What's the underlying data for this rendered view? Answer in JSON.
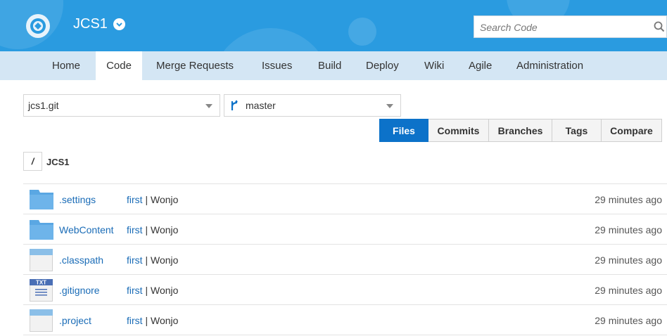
{
  "header": {
    "project_name": "JCS1",
    "search_placeholder": "Search Code"
  },
  "nav": {
    "tabs": [
      {
        "label": "Home"
      },
      {
        "label": "Code",
        "active": true
      },
      {
        "label": "Merge Requests"
      },
      {
        "label": "Issues"
      },
      {
        "label": "Build"
      },
      {
        "label": "Deploy"
      },
      {
        "label": "Wiki"
      },
      {
        "label": "Agile"
      },
      {
        "label": "Administration"
      }
    ]
  },
  "repo": {
    "selected_repo": "jcs1.git",
    "selected_branch": "master"
  },
  "view_buttons": [
    {
      "label": "Files",
      "active": true
    },
    {
      "label": "Commits"
    },
    {
      "label": "Branches"
    },
    {
      "label": "Tags"
    },
    {
      "label": "Compare"
    }
  ],
  "breadcrumb": {
    "root": "/",
    "current": "JCS1"
  },
  "files": [
    {
      "name": ".settings",
      "icon": "folder-icon",
      "commit_message": "first",
      "separator": "|",
      "author": "Wonjo",
      "time": "29 minutes ago"
    },
    {
      "name": "WebContent",
      "icon": "folder-icon",
      "commit_message": "first",
      "separator": "|",
      "author": "Wonjo",
      "time": "29 minutes ago"
    },
    {
      "name": ".classpath",
      "icon": "file-icon",
      "commit_message": "first",
      "separator": "|",
      "author": "Wonjo",
      "time": "29 minutes ago"
    },
    {
      "name": ".gitignore",
      "icon": "txt-file-icon",
      "icon_text": "TXT",
      "commit_message": "first",
      "separator": "|",
      "author": "Wonjo",
      "time": "29 minutes ago"
    },
    {
      "name": ".project",
      "icon": "file-icon",
      "commit_message": "first",
      "separator": "|",
      "author": "Wonjo",
      "time": "29 minutes ago"
    }
  ],
  "colors": {
    "banner": "#2a9be0",
    "nav_bar": "#d4e6f4",
    "active_button": "#0c72c9",
    "link": "#1a6cb7",
    "folder": "#5aa7e3"
  }
}
